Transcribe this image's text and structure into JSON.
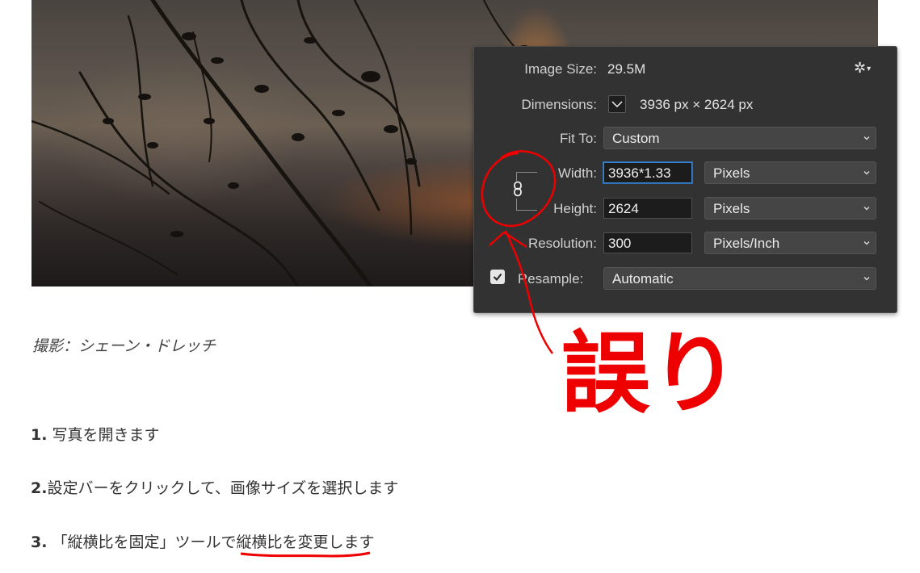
{
  "photo_caption": "撮影：シェーン・ドレッチ",
  "steps": [
    {
      "number": "1.",
      "text": "写真を開きます"
    },
    {
      "number": "2.",
      "text": "設定バーをクリックして、画像サイズを選択します"
    },
    {
      "number": "3.",
      "text_before": "「縦横比を固定」ツールで",
      "text_underlined": "縦横比を変更し",
      "text_after": "ます"
    }
  ],
  "annotation": {
    "text": "誤り",
    "color": "#ee0000"
  },
  "dialog": {
    "image_size_label": "Image Size:",
    "image_size_value": "29.5M",
    "dimensions_label": "Dimensions:",
    "dimensions_value": "3936 px  ×  2624 px",
    "fit_to_label": "Fit To:",
    "fit_to_value": "Custom",
    "width_label": "Width:",
    "width_value": "3936*1.33",
    "width_unit": "Pixels",
    "height_label": "Height:",
    "height_value": "2624",
    "height_unit": "Pixels",
    "resolution_label": "Resolution:",
    "resolution_value": "300",
    "resolution_unit": "Pixels/Inch",
    "resample_label": "Resample:",
    "resample_checked": true,
    "resample_value": "Automatic",
    "icons": [
      "gear-icon",
      "chevron-down-icon",
      "link-icon",
      "checkmark-icon"
    ]
  }
}
